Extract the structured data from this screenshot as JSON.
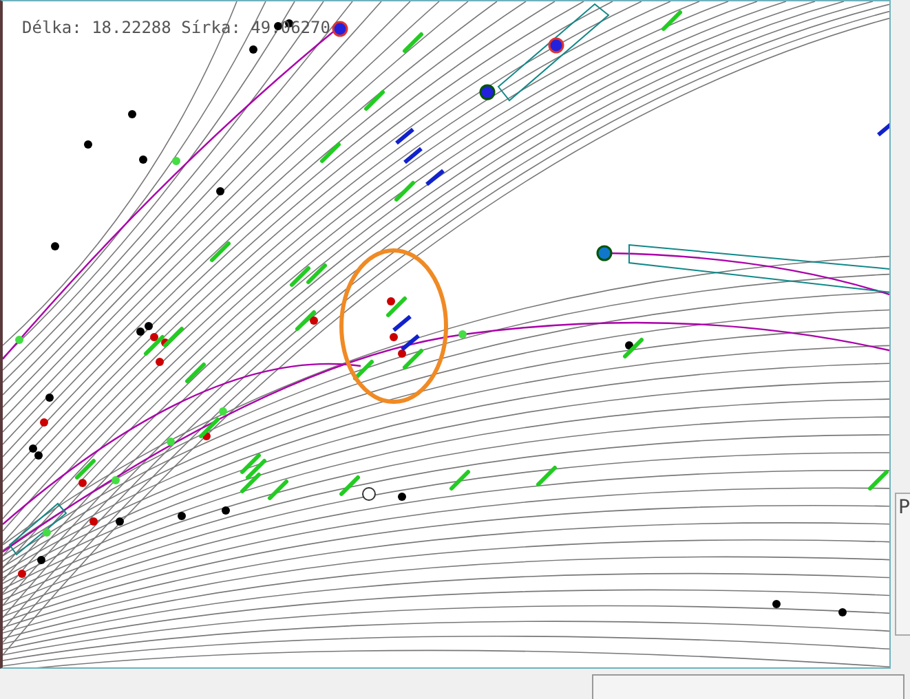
{
  "map": {
    "coordinates": "Délka: 18.22288 Sírka: 49.06270"
  },
  "side_panel": {
    "label": "P"
  }
}
